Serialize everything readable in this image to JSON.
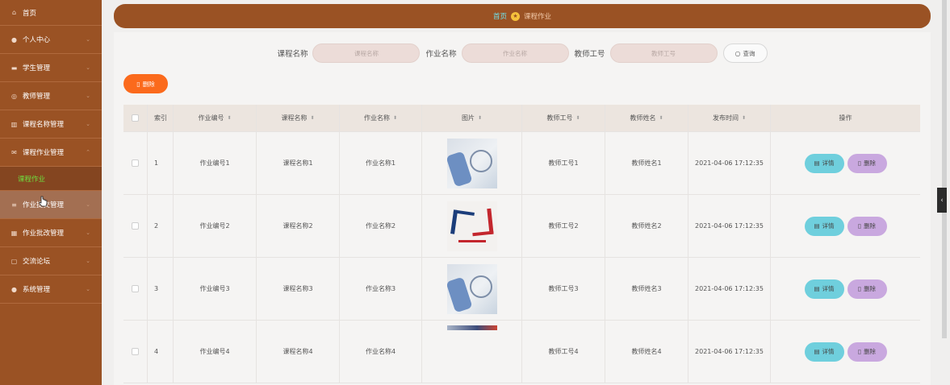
{
  "sidebar": {
    "items": [
      {
        "label": "首页",
        "icon": "home-icon",
        "arrow": false
      },
      {
        "label": "个人中心",
        "icon": "user-icon",
        "arrow": true
      },
      {
        "label": "学生管理",
        "icon": "students-icon",
        "arrow": true
      },
      {
        "label": "教师管理",
        "icon": "teacher-icon",
        "arrow": true
      },
      {
        "label": "课程名称管理",
        "icon": "chart-icon",
        "arrow": true
      },
      {
        "label": "课程作业管理",
        "icon": "mail-icon",
        "arrow": true
      },
      {
        "label": "作业提交管理",
        "icon": "list-icon",
        "arrow": true
      },
      {
        "label": "作业批改管理",
        "icon": "grid-icon",
        "arrow": true
      },
      {
        "label": "交流论坛",
        "icon": "forum-icon",
        "arrow": true
      },
      {
        "label": "系统管理",
        "icon": "settings-user-icon",
        "arrow": true
      }
    ],
    "submenu": {
      "label": "课程作业"
    }
  },
  "breadcrumb": {
    "home": "首页",
    "current": "课程作业"
  },
  "search": {
    "course_label": "课程名称",
    "course_placeholder": "课程名称",
    "homework_label": "作业名称",
    "homework_placeholder": "作业名称",
    "teacher_label": "教师工号",
    "teacher_placeholder": "教师工号",
    "query_label": "查询"
  },
  "toolbar": {
    "delete_label": "删除"
  },
  "table": {
    "headers": {
      "index": "索引",
      "hw_no": "作业编号",
      "course": "课程名称",
      "hw_name": "作业名称",
      "image": "图片",
      "teacher_no": "教师工号",
      "teacher_name": "教师姓名",
      "publish_time": "发布时间",
      "actions": "操作"
    },
    "rows": [
      {
        "index": "1",
        "hw_no": "作业编号1",
        "course": "课程名称1",
        "hw_name": "作业名称1",
        "teacher_no": "教师工号1",
        "teacher_name": "教师姓名1",
        "publish_time": "2021-04-06 17:12:35"
      },
      {
        "index": "2",
        "hw_no": "作业编号2",
        "course": "课程名称2",
        "hw_name": "作业名称2",
        "teacher_no": "教师工号2",
        "teacher_name": "教师姓名2",
        "publish_time": "2021-04-06 17:12:35"
      },
      {
        "index": "3",
        "hw_no": "作业编号3",
        "course": "课程名称3",
        "hw_name": "作业名称3",
        "teacher_no": "教师工号3",
        "teacher_name": "教师姓名3",
        "publish_time": "2021-04-06 17:12:35"
      },
      {
        "index": "4",
        "hw_no": "作业编号4",
        "course": "课程名称4",
        "hw_name": "作业名称4",
        "teacher_no": "教师工号4",
        "teacher_name": "教师姓名4",
        "publish_time": "2021-04-06 17:12:35"
      }
    ],
    "detail_label": "详情",
    "delete_label": "删除"
  },
  "colors": {
    "brand": "#9a5224",
    "accent_orange": "#fb6a1c",
    "detail_cyan": "#6fcfdd",
    "delete_purple": "#c9a8df",
    "active_green": "#6ede3e"
  }
}
